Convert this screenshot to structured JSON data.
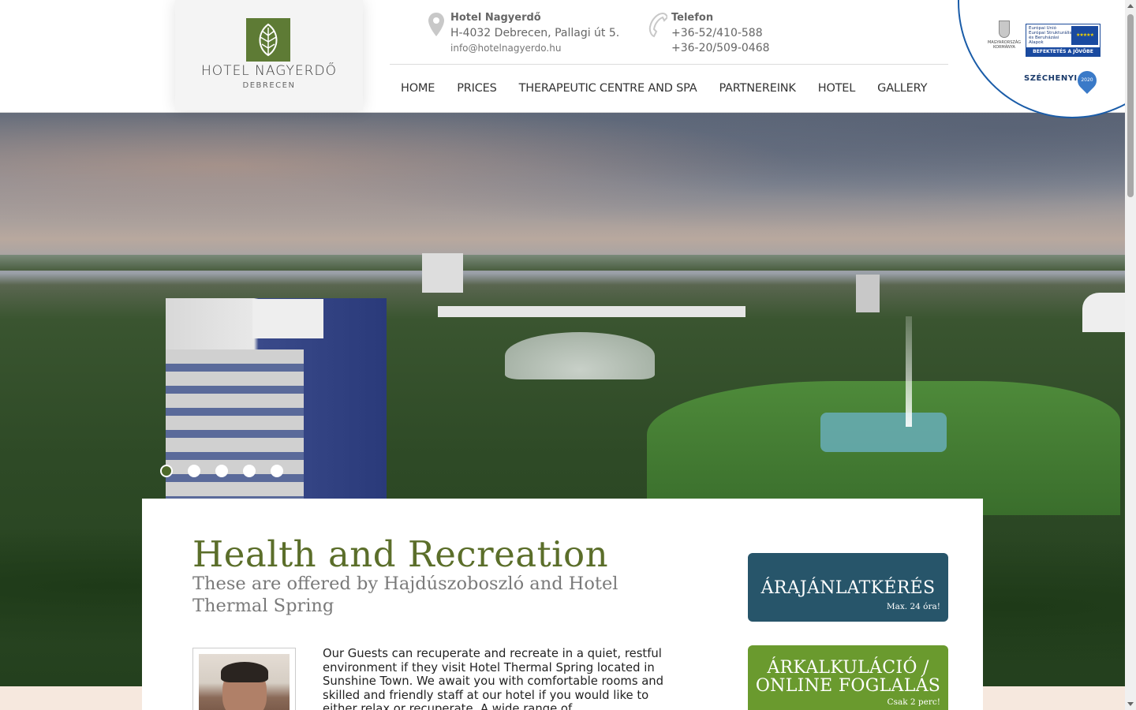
{
  "header": {
    "logo": {
      "name": "HOTEL NAGYERDŐ",
      "city": "DEBRECEN"
    },
    "address": {
      "title": "Hotel Nagyerdő",
      "line": "H-4032 Debrecen, Pallagi út 5.",
      "email": "info@hotelnagyerdo.hu",
      "icon": "map-pin-icon"
    },
    "phone": {
      "title": "Telefon",
      "line1": "+36-52/410-588",
      "line2": "+36-20/509-0468",
      "icon": "phone-icon"
    }
  },
  "nav": {
    "items": [
      {
        "label": "HOME"
      },
      {
        "label": "PRICES"
      },
      {
        "label": "THERAPEUTIC CENTRE AND SPA"
      },
      {
        "label": "PARTNEREINK"
      },
      {
        "label": "HOTEL"
      },
      {
        "label": "GALLERY"
      }
    ]
  },
  "eu_badge": {
    "hu_text": "MAGYARORSZÁG KORMÁNYA",
    "eu_text": "Európai Unió Európai Strukturális és Beruházási Alapok",
    "eu_bar": "BEFEKTETÉS A JÖVŐBE",
    "szechenyi": "SZÉCHENYI",
    "year": "2020"
  },
  "slider": {
    "dot_count": 5,
    "active_index": 0
  },
  "main": {
    "title": "Health and Recreation",
    "subtitle": "These are offered by Hajdúszoboszló and Hotel Thermal Spring",
    "intro": "Our Guests can recuperate and recreate in a quiet, restful environment if they visit Hotel Thermal Spring located in Sunshine Town. We await you with comfortable rooms and skilled and friendly staff at our hotel if you would like to either relax or recuperate. A wide range of"
  },
  "cta": {
    "quote": {
      "label": "ÁRAJÁNLATKÉRÉS",
      "sub": "Max. 24 óra!"
    },
    "calc": {
      "label": "ÁRKALKULÁCIÓ / ONLINE FOGLALÁS",
      "sub": "Csak 2 perc!"
    }
  },
  "colors": {
    "brand_green": "#5e7b35",
    "title_green": "#5b6e2a",
    "quote_blue": "#27556a",
    "calc_green": "#6a9a2e",
    "eu_blue": "#1a5ca8"
  }
}
